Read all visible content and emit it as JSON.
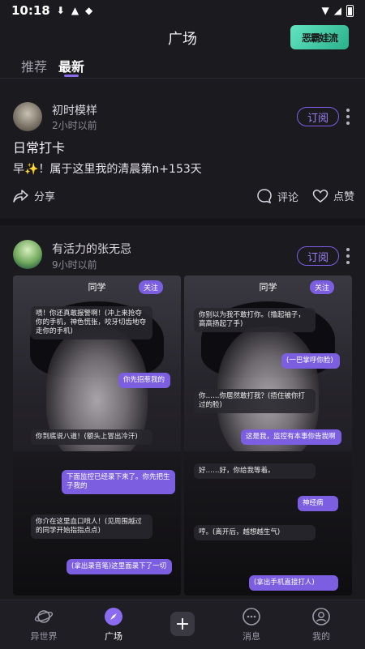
{
  "status": {
    "time": "10:18"
  },
  "header": {
    "title": "广场",
    "promo": "恶霸娃流"
  },
  "tabs": [
    {
      "label": "推荐"
    },
    {
      "label": "最新"
    }
  ],
  "posts": [
    {
      "user": "初时模样",
      "time": "2小时以前",
      "subscribe": "订阅",
      "title": "日常打卡",
      "text": "早✨！属于这里我的清晨第n+153天",
      "share": "分享",
      "comment": "评论",
      "like": "点赞"
    },
    {
      "user": "有活力的张无忌",
      "time": "9小时以前",
      "subscribe": "订阅"
    }
  ],
  "shots": [
    {
      "header": "同学",
      "follow": "关注",
      "bubbles": [
        "啧！你还真敢报警啊！(冲上来抢夺你的手机，神色慌张，咬牙切齿地夺走你的手机)",
        "你先招惹我的",
        "你到底说八道！(额头上冒出冷汗)",
        "下面监控已经录下来了。你先把生子我的",
        "你介在这里血口喷人！(见周围越过的同学开始指指点点)",
        "(拿出录音笔)这里面录下了一切"
      ]
    },
    {
      "header": "同学",
      "follow": "关注",
      "bubbles": [
        "你别以为我不敢打你。(撸起袖子，高高扬起了手)",
        "(一巴掌呼你脸)",
        "你……你居然敢打我？(捂住被你打过的脸)",
        "这是我，监控有本事你告我啊",
        "好……好，你给我等着。",
        "神经病",
        "哼。(离开后，越想越生气)",
        "(拿出手机直接打人)"
      ]
    }
  ],
  "nav": [
    {
      "label": "异世界"
    },
    {
      "label": "广场"
    },
    {
      "label": "消息"
    },
    {
      "label": "我的"
    }
  ]
}
